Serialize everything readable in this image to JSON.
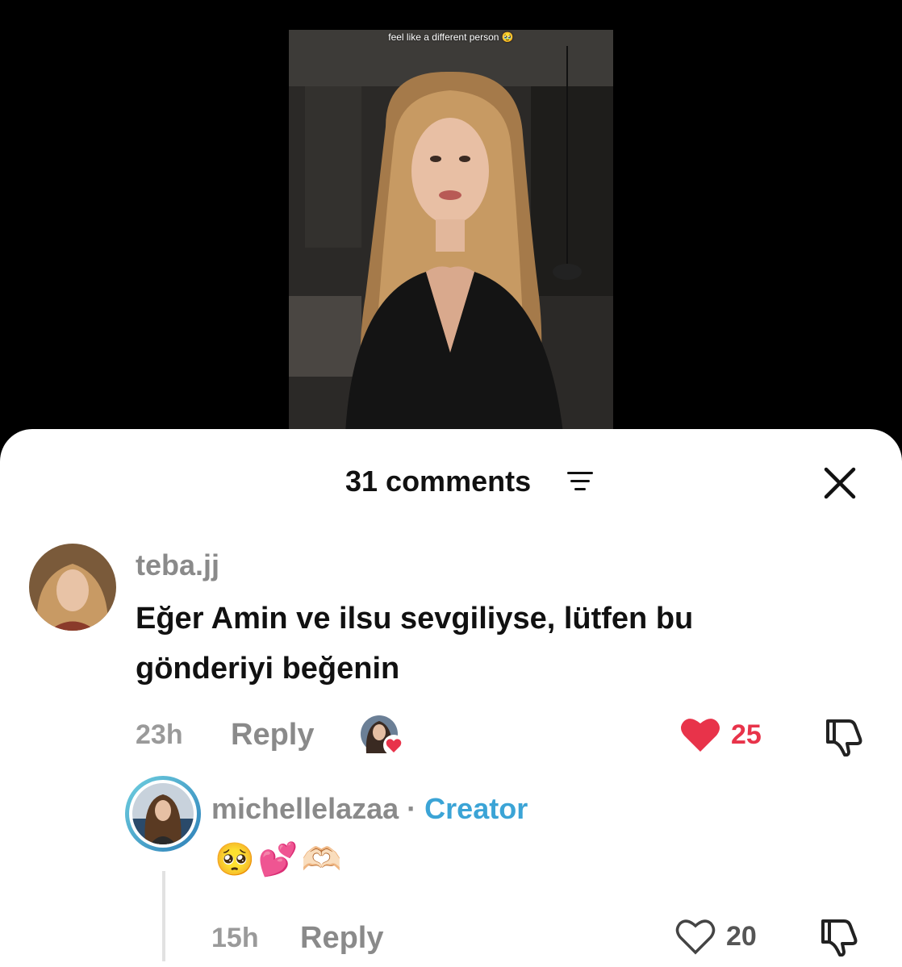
{
  "video": {
    "caption": "feel like a different person 🥹"
  },
  "header": {
    "comments_count": "31 comments"
  },
  "comments": [
    {
      "username": "teba.jj",
      "text_line1": "Eğer Amin ve ilsu sevgiliyse, lütfen bu",
      "text_line2": "gönderiyi beğenin",
      "time": "23h",
      "reply_label": "Reply",
      "likes": "25",
      "liked": true
    }
  ],
  "reply": {
    "username": "michellelazaa",
    "separator": "·",
    "badge": "Creator",
    "text": "🥺💕🫶🏻",
    "time": "15h",
    "reply_label": "Reply",
    "likes": "20",
    "liked": false
  },
  "colors": {
    "like_red": "#e8334a",
    "creator_blue": "#3ba4d6",
    "meta_gray": "#8a8a8a"
  },
  "icons": [
    "sort-icon",
    "close-icon",
    "heart-icon",
    "dislike-icon"
  ]
}
